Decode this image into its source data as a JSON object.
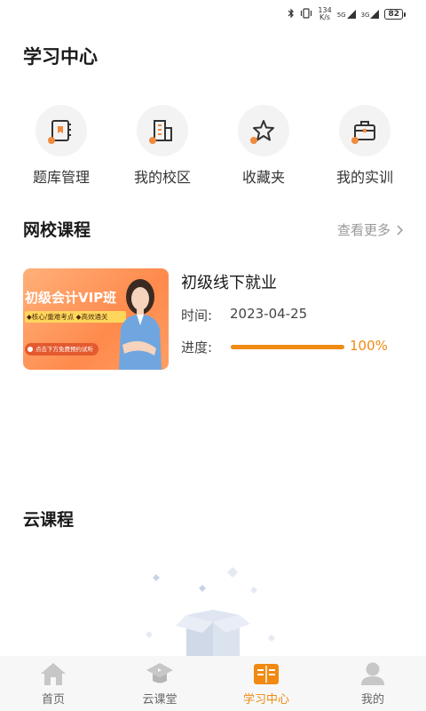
{
  "status_bar": {
    "net_speed_value": "134",
    "net_speed_unit": "K/s",
    "signal_1": "5G",
    "signal_2": "3G",
    "battery": "82"
  },
  "page": {
    "title": "学习中心"
  },
  "quick_entries": [
    {
      "label": "题库管理",
      "icon": "question-bank-icon"
    },
    {
      "label": "我的校区",
      "icon": "campus-building-icon"
    },
    {
      "label": "收藏夹",
      "icon": "star-icon"
    },
    {
      "label": "我的实训",
      "icon": "briefcase-icon"
    }
  ],
  "online_courses": {
    "title": "网校课程",
    "more_label": "查看更多",
    "course": {
      "thumbnail": {
        "title": "初级会计VIP班",
        "tagline": "◆核心/重难考点 ◆高效通关",
        "button": "点击下方免费预约试听"
      },
      "name": "初级线下就业",
      "time_label": "时间:",
      "time_value": "2023-04-25",
      "progress_label": "进度:",
      "progress_value": "100%",
      "progress_fraction": 1.0
    }
  },
  "cloud_courses": {
    "title": "云课程"
  },
  "colors": {
    "accent": "#f08a12",
    "dot": "#f08a3c"
  },
  "tab_bar": [
    {
      "label": "首页",
      "icon": "home-icon",
      "active": false
    },
    {
      "label": "云课堂",
      "icon": "graduation-cap-icon",
      "active": false
    },
    {
      "label": "学习中心",
      "icon": "open-book-icon",
      "active": true
    },
    {
      "label": "我的",
      "icon": "profile-icon",
      "active": false
    }
  ]
}
